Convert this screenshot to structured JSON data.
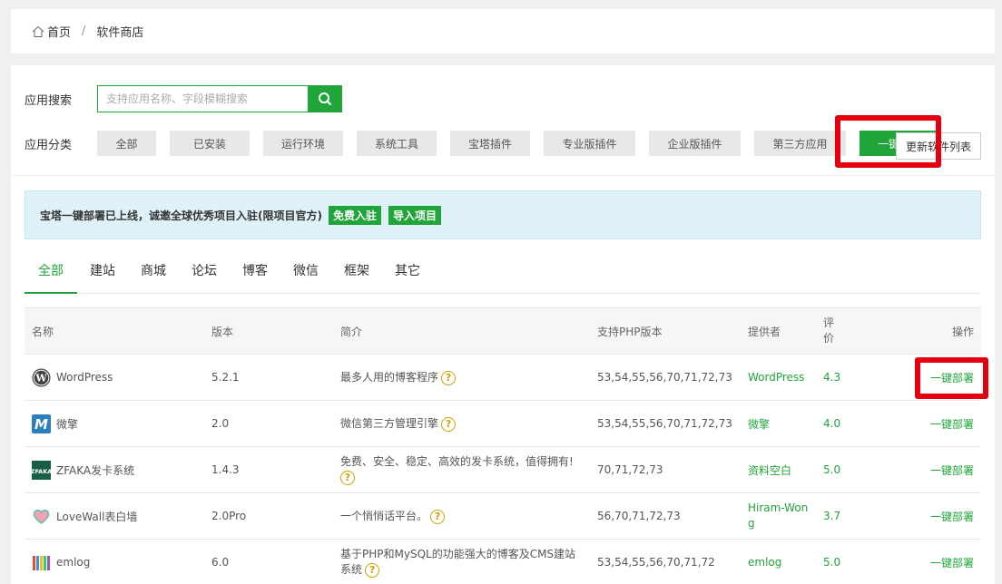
{
  "breadcrumb": {
    "home": "首页",
    "separator": "/",
    "current": "软件商店"
  },
  "search": {
    "label": "应用搜索",
    "placeholder": "支持应用名称、字段模糊搜索",
    "button_icon": "search-icon"
  },
  "categories": {
    "label": "应用分类",
    "items": [
      "全部",
      "已安装",
      "运行环境",
      "系统工具",
      "宝塔插件",
      "专业版插件",
      "企业版插件",
      "第三方应用",
      "一键部署"
    ],
    "update_button": "更新软件列表"
  },
  "notice": {
    "text": "宝塔一键部署已上线，诚邀全球优秀项目入驻(限项目官方)",
    "join_button": "免费入驻",
    "import_button": "导入项目"
  },
  "tabs": [
    "全部",
    "建站",
    "商城",
    "论坛",
    "博客",
    "微信",
    "框架",
    "其它"
  ],
  "table": {
    "headers": {
      "name": "名称",
      "version": "版本",
      "desc": "简介",
      "php": "支持PHP版本",
      "provider": "提供者",
      "rating": "评价",
      "op": "操作"
    },
    "rows": [
      {
        "name": "WordPress",
        "icon": "wordpress-icon",
        "version": "5.2.1",
        "desc": "最多人用的博客程序",
        "php": "53,54,55,56,70,71,72,73",
        "provider": "WordPress",
        "rating": "4.3",
        "op": "一键部署"
      },
      {
        "name": "微擎",
        "icon": "weengine-icon",
        "version": "2.0",
        "desc": "微信第三方管理引擎",
        "php": "53,54,55,56,70,71,72,73",
        "provider": "微擎",
        "rating": "4.0",
        "op": "一键部署"
      },
      {
        "name": "ZFAKA发卡系统",
        "icon": "zfaka-icon",
        "version": "1.4.3",
        "desc": "免费、安全、稳定、高效的发卡系统，值得拥有!",
        "php": "70,71,72,73",
        "provider": "资料空白",
        "rating": "5.0",
        "op": "一键部署"
      },
      {
        "name": "LoveWall表白墙",
        "icon": "heart-icon",
        "version": "2.0Pro",
        "desc": "一个悄悄话平台。",
        "php": "56,70,71,72,73",
        "provider": "Hiram-Wong",
        "rating": "3.7",
        "op": "一键部署"
      },
      {
        "name": "emlog",
        "icon": "emlog-icon",
        "version": "6.0",
        "desc": "基于PHP和MySQL的功能强大的博客及CMS建站系统",
        "php": "53,54,55,56,70,71,72",
        "provider": "emlog",
        "rating": "5.0",
        "op": "一键部署"
      }
    ]
  },
  "colors": {
    "accent": "#20a53a",
    "highlight": "#e6000f",
    "notice_bg": "#dff2f8"
  }
}
